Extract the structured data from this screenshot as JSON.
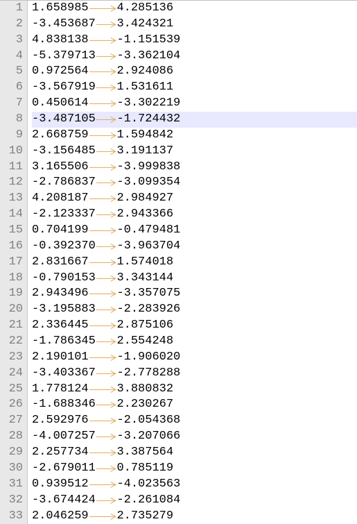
{
  "highlight_line": 8,
  "tab_glyph_color": "#e0a85a",
  "rows": [
    {
      "n": 1,
      "a": "1.658985",
      "b": "4.285136"
    },
    {
      "n": 2,
      "a": "-3.453687",
      "b": "3.424321"
    },
    {
      "n": 3,
      "a": "4.838138",
      "b": "-1.151539"
    },
    {
      "n": 4,
      "a": "-5.379713",
      "b": "-3.362104"
    },
    {
      "n": 5,
      "a": "0.972564",
      "b": "2.924086"
    },
    {
      "n": 6,
      "a": "-3.567919",
      "b": "1.531611"
    },
    {
      "n": 7,
      "a": "0.450614",
      "b": "-3.302219"
    },
    {
      "n": 8,
      "a": "-3.487105",
      "b": "-1.724432"
    },
    {
      "n": 9,
      "a": "2.668759",
      "b": "1.594842"
    },
    {
      "n": 10,
      "a": "-3.156485",
      "b": "3.191137"
    },
    {
      "n": 11,
      "a": "3.165506",
      "b": "-3.999838"
    },
    {
      "n": 12,
      "a": "-2.786837",
      "b": "-3.099354"
    },
    {
      "n": 13,
      "a": "4.208187",
      "b": "2.984927"
    },
    {
      "n": 14,
      "a": "-2.123337",
      "b": "2.943366"
    },
    {
      "n": 15,
      "a": "0.704199",
      "b": "-0.479481"
    },
    {
      "n": 16,
      "a": "-0.392370",
      "b": "-3.963704"
    },
    {
      "n": 17,
      "a": "2.831667",
      "b": "1.574018"
    },
    {
      "n": 18,
      "a": "-0.790153",
      "b": "3.343144"
    },
    {
      "n": 19,
      "a": "2.943496",
      "b": "-3.357075"
    },
    {
      "n": 20,
      "a": "-3.195883",
      "b": "-2.283926"
    },
    {
      "n": 21,
      "a": "2.336445",
      "b": "2.875106"
    },
    {
      "n": 22,
      "a": "-1.786345",
      "b": "2.554248"
    },
    {
      "n": 23,
      "a": "2.190101",
      "b": "-1.906020"
    },
    {
      "n": 24,
      "a": "-3.403367",
      "b": "-2.778288"
    },
    {
      "n": 25,
      "a": "1.778124",
      "b": "3.880832"
    },
    {
      "n": 26,
      "a": "-1.688346",
      "b": "2.230267"
    },
    {
      "n": 27,
      "a": "2.592976",
      "b": "-2.054368"
    },
    {
      "n": 28,
      "a": "-4.007257",
      "b": "-3.207066"
    },
    {
      "n": 29,
      "a": "2.257734",
      "b": "3.387564"
    },
    {
      "n": 30,
      "a": "-2.679011",
      "b": "0.785119"
    },
    {
      "n": 31,
      "a": "0.939512",
      "b": "-4.023563"
    },
    {
      "n": 32,
      "a": "-3.674424",
      "b": "-2.261084"
    },
    {
      "n": 33,
      "a": "2.046259",
      "b": "2.735279"
    }
  ]
}
